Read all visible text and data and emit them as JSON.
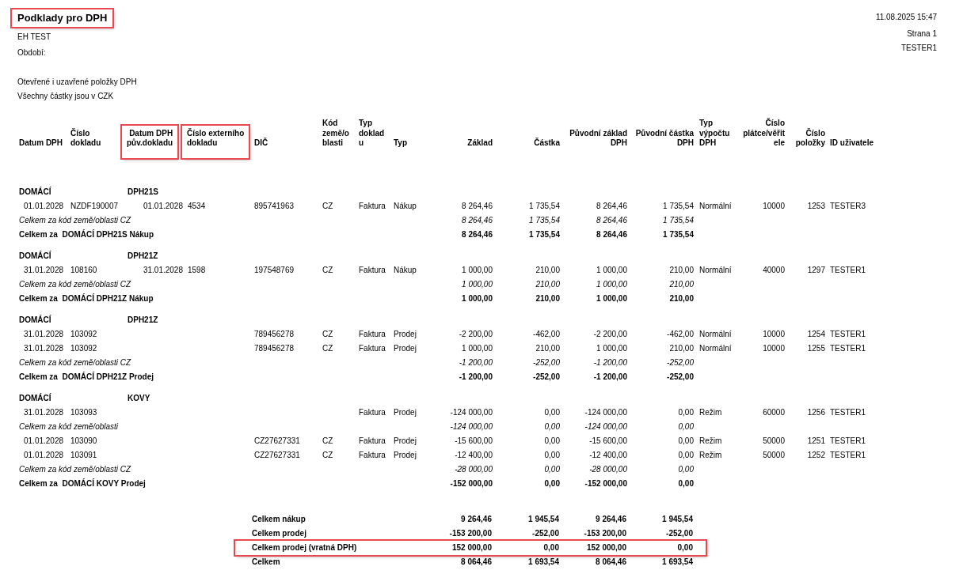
{
  "report": {
    "title": {
      "text": "Podklady pro DPH",
      "highlighted": true
    },
    "company": "EH TEST",
    "period_label": "Období:",
    "filter_note": "Otevřené i uzavřené položky DPH",
    "currency_note": "Všechny částky jsou v CZK",
    "printed_at": "11.08.2025 15:47",
    "page": "Strana 1",
    "user": "TESTER1"
  },
  "table": {
    "columns": [
      {
        "label": "Datum DPH",
        "highlighted": false
      },
      {
        "label": "Číslo\ndokladu",
        "highlighted": false
      },
      {
        "label": "Datum DPH\npův.dokladu",
        "highlighted": true
      },
      {
        "label": "Číslo externího\ndokladu",
        "highlighted": true
      },
      {
        "label": "DIČ",
        "highlighted": false
      },
      {
        "label": "Kód\nzemě/o\nblasti",
        "highlighted": false
      },
      {
        "label": "Typ\ndoklad\nu",
        "highlighted": false
      },
      {
        "label": "Typ",
        "highlighted": false
      },
      {
        "label": "Základ",
        "highlighted": false
      },
      {
        "label": "Částka",
        "highlighted": false
      },
      {
        "label": "Původní základ\nDPH",
        "highlighted": false
      },
      {
        "label": "Původní částka\nDPH",
        "highlighted": false
      },
      {
        "label": "Typ\nvýpočtu\nDPH",
        "highlighted": false
      },
      {
        "label": "Číslo\nplátce/věřit\nele",
        "highlighted": false
      },
      {
        "label": "Číslo\npoložky",
        "highlighted": false
      },
      {
        "label": "ID uživatele",
        "highlighted": false
      }
    ],
    "groups": [
      {
        "area": "DOMÁCÍ",
        "code": "DPH21S",
        "rows": [
          {
            "kind": "entry",
            "cells": [
              "01.01.2028",
              "NZDF190007",
              "01.01.2028",
              "4534",
              "895741963",
              "CZ",
              "Faktura",
              "Nákup",
              "8 264,46",
              "1 735,54",
              "8 264,46",
              "1 735,54",
              "Normální",
              "10000",
              "1253",
              "TESTER3"
            ]
          },
          {
            "kind": "subtotal",
            "label": "Celkem za kód země/oblasti CZ",
            "amounts": [
              "8 264,46",
              "1 735,54",
              "8 264,46",
              "1 735,54"
            ]
          },
          {
            "kind": "total",
            "label": "Celkem za  DOMÁCÍ DPH21S Nákup",
            "amounts": [
              "8 264,46",
              "1 735,54",
              "8 264,46",
              "1 735,54"
            ]
          }
        ]
      },
      {
        "area": "DOMÁCÍ",
        "code": "DPH21Z",
        "rows": [
          {
            "kind": "entry",
            "cells": [
              "31.01.2028",
              "108160",
              "31.01.2028",
              "1598",
              "197548769",
              "CZ",
              "Faktura",
              "Nákup",
              "1 000,00",
              "210,00",
              "1 000,00",
              "210,00",
              "Normální",
              "40000",
              "1297",
              "TESTER1"
            ]
          },
          {
            "kind": "subtotal",
            "label": "Celkem za kód země/oblasti CZ",
            "amounts": [
              "1 000,00",
              "210,00",
              "1 000,00",
              "210,00"
            ]
          },
          {
            "kind": "total",
            "label": "Celkem za  DOMÁCÍ DPH21Z Nákup",
            "amounts": [
              "1 000,00",
              "210,00",
              "1 000,00",
              "210,00"
            ]
          }
        ]
      },
      {
        "area": "DOMÁCÍ",
        "code": "DPH21Z",
        "rows": [
          {
            "kind": "entry",
            "cells": [
              "31.01.2028",
              "103092",
              null,
              null,
              "789456278",
              "CZ",
              "Faktura",
              "Prodej",
              "-2 200,00",
              "-462,00",
              "-2 200,00",
              "-462,00",
              "Normální",
              "10000",
              "1254",
              "TESTER1"
            ]
          },
          {
            "kind": "entry",
            "cells": [
              "31.01.2028",
              "103092",
              null,
              null,
              "789456278",
              "CZ",
              "Faktura",
              "Prodej",
              "1 000,00",
              "210,00",
              "1 000,00",
              "210,00",
              "Normální",
              "10000",
              "1255",
              "TESTER1"
            ]
          },
          {
            "kind": "subtotal",
            "label": "Celkem za kód země/oblasti CZ",
            "amounts": [
              "-1 200,00",
              "-252,00",
              "-1 200,00",
              "-252,00"
            ]
          },
          {
            "kind": "total",
            "label": "Celkem za  DOMÁCÍ DPH21Z Prodej",
            "amounts": [
              "-1 200,00",
              "-252,00",
              "-1 200,00",
              "-252,00"
            ]
          }
        ]
      },
      {
        "area": "DOMÁCÍ",
        "code": "KOVY",
        "rows": [
          {
            "kind": "entry",
            "cells": [
              "31.01.2028",
              "103093",
              null,
              null,
              null,
              null,
              "Faktura",
              "Prodej",
              "-124 000,00",
              "0,00",
              "-124 000,00",
              "0,00",
              "Režim",
              "60000",
              "1256",
              "TESTER1"
            ]
          },
          {
            "kind": "subtotal",
            "label": "Celkem za kód země/oblasti",
            "amounts": [
              "-124 000,00",
              "0,00",
              "-124 000,00",
              "0,00"
            ]
          },
          {
            "kind": "entry",
            "cells": [
              "01.01.2028",
              "103090",
              null,
              null,
              "CZ27627331",
              "CZ",
              "Faktura",
              "Prodej",
              "-15 600,00",
              "0,00",
              "-15 600,00",
              "0,00",
              "Režim",
              "50000",
              "1251",
              "TESTER1"
            ]
          },
          {
            "kind": "entry",
            "cells": [
              "01.01.2028",
              "103091",
              null,
              null,
              "CZ27627331",
              "CZ",
              "Faktura",
              "Prodej",
              "-12 400,00",
              "0,00",
              "-12 400,00",
              "0,00",
              "Režim",
              "50000",
              "1252",
              "TESTER1"
            ]
          },
          {
            "kind": "subtotal",
            "label": "Celkem za kód země/oblasti CZ",
            "amounts": [
              "-28 000,00",
              "0,00",
              "-28 000,00",
              "0,00"
            ]
          },
          {
            "kind": "total",
            "label": "Celkem za  DOMÁCÍ KOVY Prodej",
            "amounts": [
              "-152 000,00",
              "0,00",
              "-152 000,00",
              "0,00"
            ]
          }
        ]
      }
    ]
  },
  "summary": [
    {
      "label": "Celkem nákup",
      "amounts": [
        "9 264,46",
        "1 945,54",
        "9 264,46",
        "1 945,54"
      ],
      "highlighted": false
    },
    {
      "label": "Celkem prodej",
      "amounts": [
        "-153 200,00",
        "-252,00",
        "-153 200,00",
        "-252,00"
      ],
      "highlighted": false
    },
    {
      "label": "Celkem prodej (vratná DPH)",
      "amounts": [
        "152 000,00",
        "0,00",
        "152 000,00",
        "0,00"
      ],
      "highlighted": true
    },
    {
      "label": "Celkem",
      "amounts": [
        "8 064,46",
        "1 693,54",
        "8 064,46",
        "1 693,54"
      ],
      "highlighted": false
    }
  ]
}
